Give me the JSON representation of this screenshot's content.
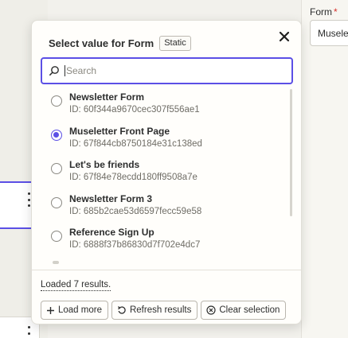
{
  "background": {
    "form_field": {
      "label": "Form",
      "required_mark": "*",
      "value": "Musele"
    }
  },
  "popover": {
    "title": "Select value for Form",
    "badge": "Static",
    "close_icon": "close-icon",
    "search": {
      "placeholder": "Search",
      "value": ""
    },
    "results": [
      {
        "name": "Newsletter Form",
        "id": "ID: 60f344a9670cec307f556ae1",
        "selected": false
      },
      {
        "name": "Museletter Front Page",
        "id": "ID: 67f844cb8750184e31c138ed",
        "selected": true
      },
      {
        "name": "Let's be friends",
        "id": "ID: 67f84e78ecdd180ff9508a7e",
        "selected": false
      },
      {
        "name": "Newsletter Form 3",
        "id": "ID: 685b2cae53d6597fecc59e58",
        "selected": false
      },
      {
        "name": "Reference Sign Up",
        "id": "ID: 6888f37b86830d7f702e4dc7",
        "selected": false
      }
    ],
    "status": "Loaded 7 results.",
    "buttons": {
      "load_more": "Load more",
      "refresh": "Refresh results",
      "clear": "Clear selection"
    }
  },
  "colors": {
    "accent": "#5b4fe5",
    "required": "#d6322d"
  }
}
